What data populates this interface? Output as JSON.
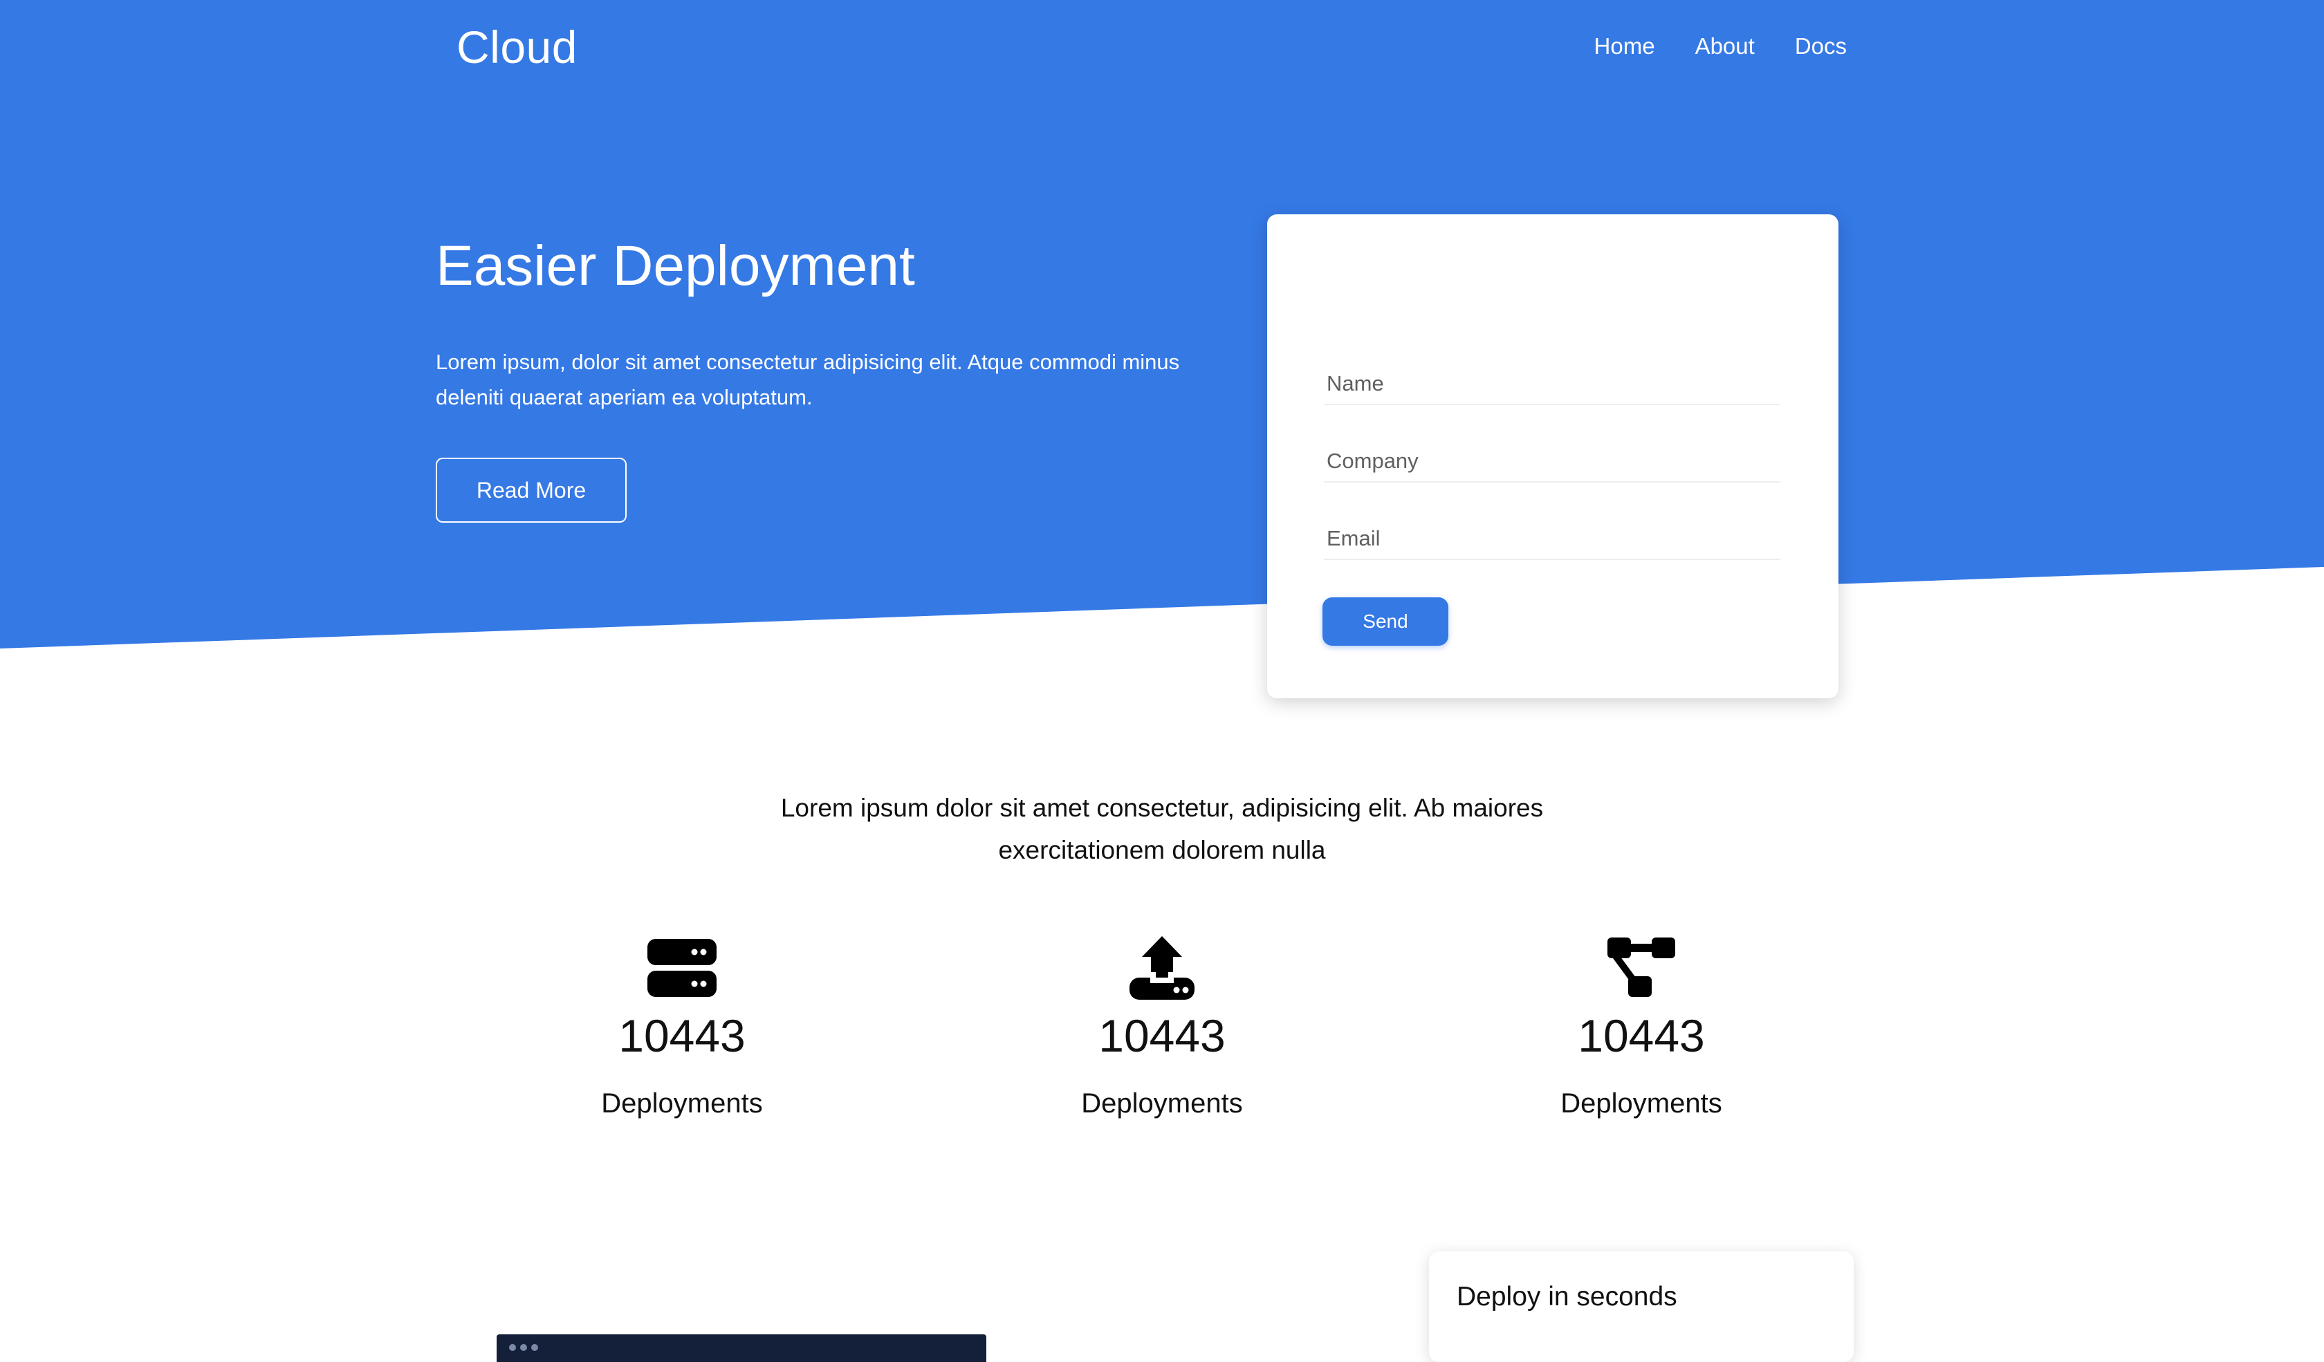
{
  "header": {
    "brand": "Cloud",
    "nav": [
      {
        "label": "Home"
      },
      {
        "label": "About"
      },
      {
        "label": "Docs"
      }
    ]
  },
  "hero": {
    "title": "Easier Deployment",
    "text": "Lorem ipsum, dolor sit amet consectetur adipisicing elit. Atque commodi minus deleniti quaerat aperiam ea voluptatum.",
    "button_label": "Read More"
  },
  "form": {
    "name_placeholder": "Name",
    "company_placeholder": "Company",
    "email_placeholder": "Email",
    "send_label": "Send"
  },
  "intro": {
    "text": "Lorem ipsum dolor sit amet consectetur, adipisicing elit. Ab maiores exercitationem dolorem nulla"
  },
  "stats": [
    {
      "icon": "server-icon",
      "value": "10443",
      "label": "Deployments"
    },
    {
      "icon": "upload-icon",
      "value": "10443",
      "label": "Deployments"
    },
    {
      "icon": "project-diagram-icon",
      "value": "10443",
      "label": "Deployments"
    }
  ],
  "feature": {
    "card_title": "Deploy in seconds"
  },
  "colors": {
    "primary": "#3579e5",
    "terminal": "#14203a"
  }
}
